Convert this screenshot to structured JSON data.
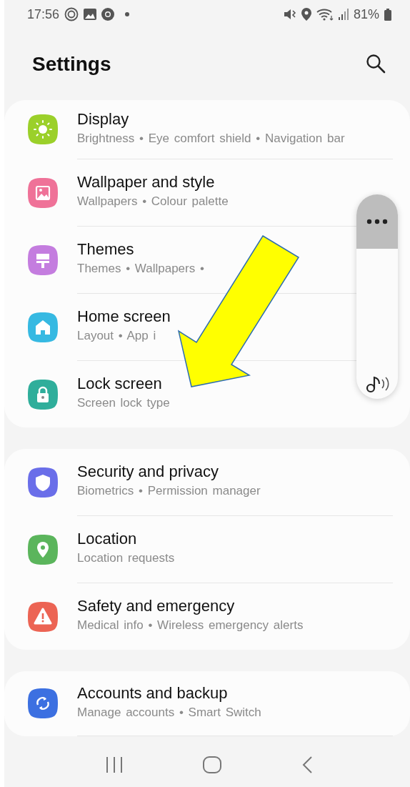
{
  "status_bar": {
    "time": "17:56",
    "battery": "81%"
  },
  "header": {
    "title": "Settings"
  },
  "groups": [
    {
      "items": [
        {
          "title": "Display",
          "summary": "Brightness • Eye comfort shield • Navigation bar",
          "color": "#9bd02a"
        },
        {
          "title": "Wallpaper and style",
          "summary": "Wallpapers • Colour palette",
          "color": "#ef7298"
        },
        {
          "title": "Themes",
          "summary": "Themes • Wallpapers •",
          "color": "#c47ddf"
        },
        {
          "title": "Home screen",
          "summary": "Layout • App i",
          "color": "#36b9e2"
        },
        {
          "title": "Lock screen",
          "summary": "Screen lock type",
          "color": "#2fae9b"
        }
      ]
    },
    {
      "items": [
        {
          "title": "Security and privacy",
          "summary": "Biometrics • Permission manager",
          "color": "#6a6ee9"
        },
        {
          "title": "Location",
          "summary": "Location requests",
          "color": "#5bb55c"
        },
        {
          "title": "Safety and emergency",
          "summary": "Medical info • Wireless emergency alerts",
          "color": "#ec6454"
        }
      ]
    },
    {
      "items": [
        {
          "title": "Accounts and backup",
          "summary": "Manage accounts • Smart Switch",
          "color": "#3c70e1"
        }
      ]
    }
  ],
  "volume_panel": {
    "level": 0
  }
}
